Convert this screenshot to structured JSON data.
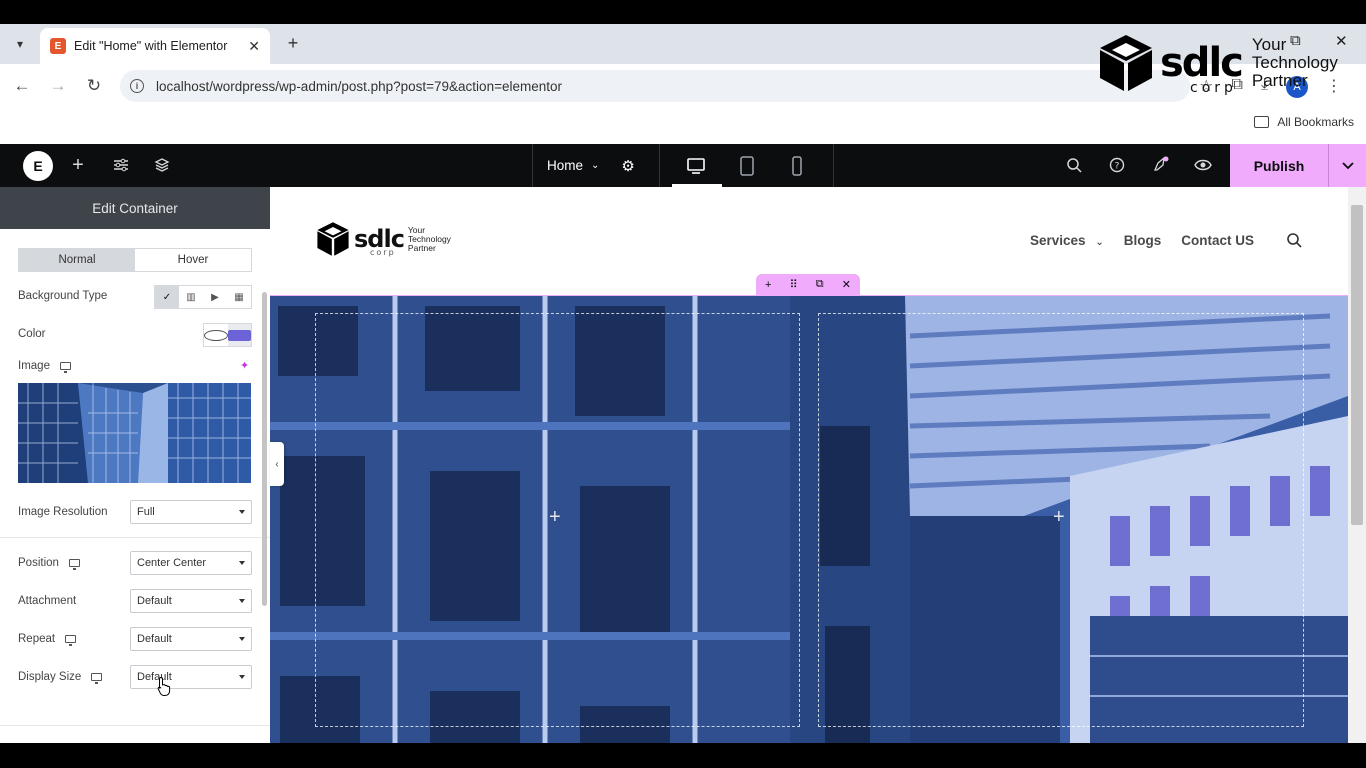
{
  "browser": {
    "tab_title": "Edit \"Home\" with Elementor",
    "tab_close": "✕",
    "new_tab": "+",
    "url": "localhost/wordpress/wp-admin/post.php?post=79&action=elementor",
    "avatar_letter": "A",
    "bookmarks_label": "All Bookmarks",
    "minimize": "–",
    "restore": "⧉",
    "close": "✕"
  },
  "watermark": {
    "brand": "sdlc",
    "corp": "corp",
    "tagline": [
      "Your",
      "Technology",
      "Partner"
    ]
  },
  "elementor": {
    "page_name": "Home",
    "publish_label": "Publish",
    "panel_title": "Edit Container",
    "state_tabs": [
      "Normal",
      "Hover"
    ],
    "controls": {
      "background_type_label": "Background Type",
      "color_label": "Color",
      "image_label": "Image",
      "image_resolution_label": "Image Resolution",
      "image_resolution_value": "Full",
      "position_label": "Position",
      "position_value": "Center Center",
      "attachment_label": "Attachment",
      "attachment_value": "Default",
      "repeat_label": "Repeat",
      "repeat_value": "Default",
      "display_size_label": "Display Size",
      "display_size_value": "Default"
    },
    "accent_color": "#f0abfc",
    "swatch_color": "#6c63d9"
  },
  "site": {
    "brand": "sdlc",
    "corp": "corp",
    "tagline": [
      "Your",
      "Technology",
      "Partner"
    ],
    "nav": [
      "Services",
      "Blogs",
      "Contact US"
    ]
  }
}
